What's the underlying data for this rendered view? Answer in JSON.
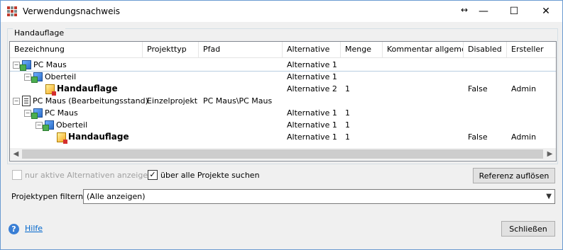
{
  "window": {
    "title": "Verwendungsnachweis",
    "controls": {
      "resize": "↔",
      "minimize": "—",
      "maximize": "☐",
      "close": "✕"
    }
  },
  "group": {
    "label": "Handauflage"
  },
  "grid": {
    "columns": [
      "Bezeichnung",
      "Projekttyp",
      "Pfad",
      "Alternative",
      "Menge",
      "Kommentar allgemein",
      "Disabled",
      "Ersteller"
    ],
    "rows": [
      {
        "name": "PC Maus",
        "bold": false,
        "icon": "assembly-icon",
        "expander": "⊟",
        "projekttyp": "",
        "pfad": "",
        "alternative": "Alternative 1",
        "menge": "",
        "kommentar": "",
        "disabled": "",
        "ersteller": ""
      },
      {
        "name": "Oberteil",
        "bold": false,
        "icon": "assembly-icon",
        "expander": "⊟",
        "projekttyp": "",
        "pfad": "",
        "alternative": "Alternative 1",
        "menge": "",
        "kommentar": "",
        "disabled": "",
        "ersteller": ""
      },
      {
        "name": "Handauflage",
        "bold": true,
        "icon": "part-icon",
        "expander": "",
        "projekttyp": "",
        "pfad": "",
        "alternative": "Alternative 2",
        "menge": "1",
        "kommentar": "",
        "disabled": "False",
        "ersteller": "Admin"
      },
      {
        "name": "PC Maus (Bearbeitungsstand)",
        "bold": false,
        "icon": "project-icon",
        "expander": "⊟",
        "projekttyp": "Einzelprojekt",
        "pfad": "PC Maus\\PC Maus",
        "alternative": "",
        "menge": "",
        "kommentar": "",
        "disabled": "",
        "ersteller": ""
      },
      {
        "name": "PC Maus",
        "bold": false,
        "icon": "assembly-icon",
        "expander": "⊟",
        "projekttyp": "",
        "pfad": "",
        "alternative": "Alternative 1",
        "menge": "1",
        "kommentar": "",
        "disabled": "",
        "ersteller": ""
      },
      {
        "name": "Oberteil",
        "bold": false,
        "icon": "assembly-icon",
        "expander": "⊟",
        "projekttyp": "",
        "pfad": "",
        "alternative": "Alternative 1",
        "menge": "1",
        "kommentar": "",
        "disabled": "",
        "ersteller": ""
      },
      {
        "name": "Handauflage",
        "bold": true,
        "icon": "part-icon",
        "expander": "",
        "projekttyp": "",
        "pfad": "",
        "alternative": "Alternative 1",
        "menge": "1",
        "kommentar": "",
        "disabled": "False",
        "ersteller": "Admin"
      }
    ],
    "scroll": {
      "left": "◀",
      "right": "▶"
    }
  },
  "options": {
    "only_active_label": "nur aktive Alternativen anzeigen",
    "only_active_checked": false,
    "all_projects_label": "über alle Projekte suchen",
    "all_projects_checked": true,
    "resolve_button": "Referenz auflösen"
  },
  "filter": {
    "label": "Projektypen filtern:",
    "value": "(Alle anzeigen)"
  },
  "footer": {
    "help_icon": "?",
    "help_label": "Hilfe",
    "close_button": "Schließen"
  }
}
